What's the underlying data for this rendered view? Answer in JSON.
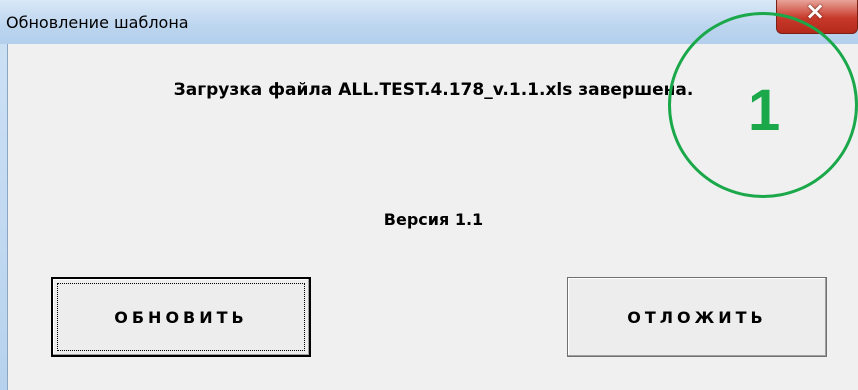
{
  "window": {
    "title": "Обновление шаблона",
    "close_icon": "×"
  },
  "dialog": {
    "message": "Загрузка файла ALL.TEST.4.178_v.1.1.xls завершена.",
    "version": "Версия 1.1"
  },
  "buttons": {
    "update_label": "ОБНОВИТЬ",
    "postpone_label": "ОТЛОЖИТЬ"
  },
  "annotation": {
    "number": "1",
    "color": "#1aa84a"
  }
}
